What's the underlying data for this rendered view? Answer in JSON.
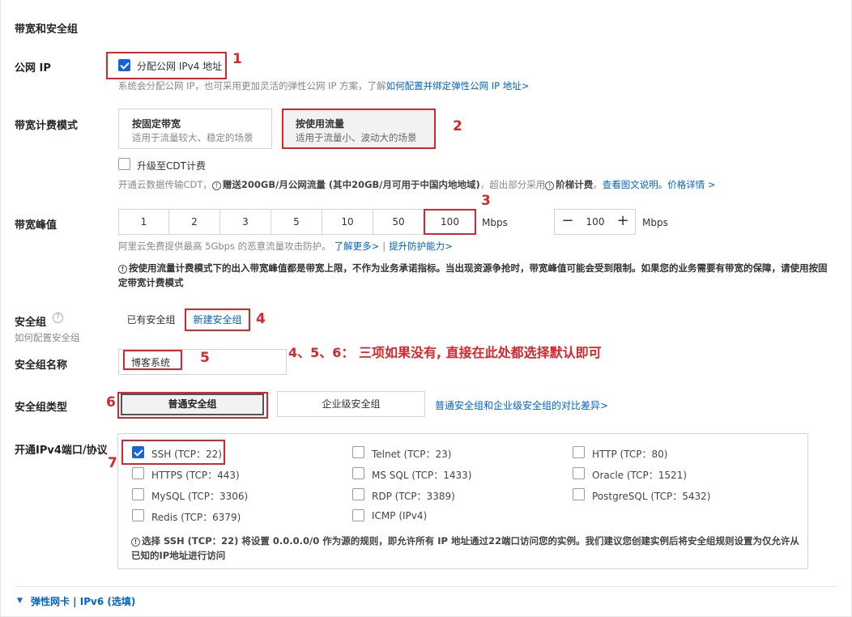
{
  "section_title": "带宽和安全组",
  "public_ip": {
    "label": "公网 IP",
    "checkbox_label": "分配公网 IPv4 地址",
    "hint": "系统会分配公网 IP，也可采用更加灵活的弹性公网 IP 方案，了解",
    "hint_link": "如何配置并绑定弹性公网 IP 地址>"
  },
  "billing": {
    "label": "带宽计费模式",
    "options": [
      {
        "title": "按固定带宽",
        "desc": "适用于流量较大、稳定的场景"
      },
      {
        "title": "按使用流量",
        "desc": "适用于流量小、波动大的场景"
      }
    ],
    "cdt_label": "升级至CDT计费",
    "cdt_hint_pre": "开通云数据传输CDT，",
    "cdt_hint_bold": "赠送200GB/月公网流量 (其中20GB/月可用于中国内地地域)",
    "cdt_hint_mid": "，超出部分采用",
    "cdt_hint_bold2": "阶梯计费",
    "cdt_hint_end": "。",
    "cdt_link1": "查看图文说明。",
    "cdt_link2": "价格详情 >"
  },
  "bandwidth": {
    "label": "带宽峰值",
    "options": [
      "1",
      "2",
      "3",
      "5",
      "10",
      "50",
      "100"
    ],
    "unit": "Mbps",
    "stepper_minus": "−",
    "stepper_value": "100",
    "stepper_plus": "+",
    "stepper_unit": "Mbps",
    "hint": "阿里云免费提供最高 5Gbps 的恶意流量攻击防护。",
    "hint_link1": "了解更多>",
    "hint_sep": "|",
    "hint_link2": "提升防护能力>",
    "note": "按使用流量计费模式下的出入带宽峰值都是带宽上限，不作为业务承诺指标。当出现资源争抢时，带宽峰值可能会受到限制。如果您的业务需要有带宽的保障，请使用按固定带宽计费模式"
  },
  "security_group": {
    "label": "安全组",
    "help_icon": "?",
    "sub_hint": "如何配置安全组",
    "tabs": [
      "已有安全组",
      "新建安全组"
    ],
    "name_label": "安全组名称",
    "name_value": "博客系统",
    "type_label": "安全组类型",
    "types": [
      "普通安全组",
      "企业级安全组"
    ],
    "type_link": "普通安全组和企业级安全组的对比差异>",
    "annotation": "4、5、6： 三项如果没有, 直接在此处都选择默认即可"
  },
  "ports": {
    "label": "开通IPv4端口/协议",
    "items": [
      {
        "label": "SSH (TCP：22)",
        "checked": true
      },
      {
        "label": "Telnet (TCP：23)",
        "checked": false
      },
      {
        "label": "HTTP (TCP：80)",
        "checked": false
      },
      {
        "label": "HTTPS (TCP：443)",
        "checked": false
      },
      {
        "label": "MS SQL (TCP：1433)",
        "checked": false
      },
      {
        "label": "Oracle (TCP：1521)",
        "checked": false
      },
      {
        "label": "MySQL (TCP：3306)",
        "checked": false
      },
      {
        "label": "RDP (TCP：3389)",
        "checked": false
      },
      {
        "label": "PostgreSQL (TCP：5432)",
        "checked": false
      },
      {
        "label": "Redis (TCP：6379)",
        "checked": false
      },
      {
        "label": "ICMP  (IPv4)",
        "checked": false
      }
    ],
    "note": "选择 SSH (TCP：22) 将设置 0.0.0.0/0 作为源的规则，即允许所有 IP 地址通过22端口访问您的实例。我们建议您创建实例后将安全组规则设置为仅允许从已知的IP地址进行访问"
  },
  "footer": {
    "toggle_label": "弹性网卡 | IPv6 (选填)"
  },
  "annotations": {
    "n1": "1",
    "n2": "2",
    "n3": "3",
    "n4": "4",
    "n5": "5",
    "n6": "6",
    "n7": "7"
  },
  "colors": {
    "accent": "#1565d8",
    "annotation_red": "#d9262c",
    "link": "#0064c8"
  }
}
